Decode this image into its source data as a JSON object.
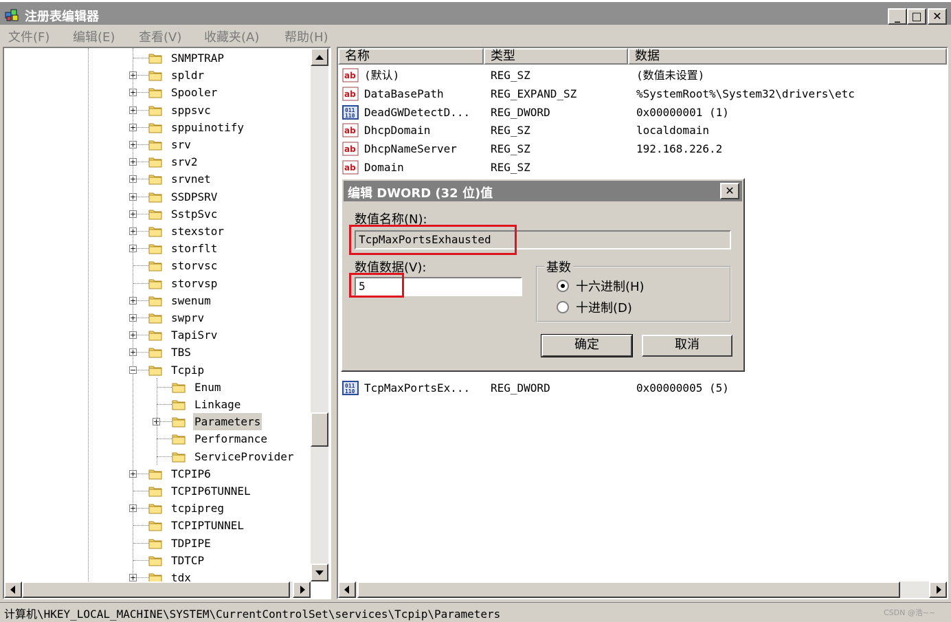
{
  "window": {
    "title": "注册表编辑器",
    "min_glyph": "_",
    "max_glyph": "□",
    "close_glyph": "✕"
  },
  "menu": [
    "文件(F)",
    "编辑(E)",
    "查看(V)",
    "收藏夹(A)",
    "帮助(H)"
  ],
  "tree": {
    "items": [
      {
        "label": "SNMPTRAP",
        "level": 0,
        "expander": ""
      },
      {
        "label": "spldr",
        "level": 0,
        "expander": "+"
      },
      {
        "label": "Spooler",
        "level": 0,
        "expander": "+"
      },
      {
        "label": "sppsvc",
        "level": 0,
        "expander": "+"
      },
      {
        "label": "sppuinotify",
        "level": 0,
        "expander": "+"
      },
      {
        "label": "srv",
        "level": 0,
        "expander": "+"
      },
      {
        "label": "srv2",
        "level": 0,
        "expander": "+"
      },
      {
        "label": "srvnet",
        "level": 0,
        "expander": "+"
      },
      {
        "label": "SSDPSRV",
        "level": 0,
        "expander": "+"
      },
      {
        "label": "SstpSvc",
        "level": 0,
        "expander": "+"
      },
      {
        "label": "stexstor",
        "level": 0,
        "expander": "+"
      },
      {
        "label": "storflt",
        "level": 0,
        "expander": "+"
      },
      {
        "label": "storvsc",
        "level": 0,
        "expander": ""
      },
      {
        "label": "storvsp",
        "level": 0,
        "expander": ""
      },
      {
        "label": "swenum",
        "level": 0,
        "expander": "+"
      },
      {
        "label": "swprv",
        "level": 0,
        "expander": "+"
      },
      {
        "label": "TapiSrv",
        "level": 0,
        "expander": "+"
      },
      {
        "label": "TBS",
        "level": 0,
        "expander": "+"
      },
      {
        "label": "Tcpip",
        "level": 0,
        "expander": "−"
      },
      {
        "label": "Enum",
        "level": 1,
        "expander": ""
      },
      {
        "label": "Linkage",
        "level": 1,
        "expander": ""
      },
      {
        "label": "Parameters",
        "level": 1,
        "expander": "+",
        "selected": true
      },
      {
        "label": "Performance",
        "level": 1,
        "expander": ""
      },
      {
        "label": "ServiceProvider",
        "level": 1,
        "expander": ""
      },
      {
        "label": "TCPIP6",
        "level": 0,
        "expander": "+"
      },
      {
        "label": "TCPIP6TUNNEL",
        "level": 0,
        "expander": ""
      },
      {
        "label": "tcpipreg",
        "level": 0,
        "expander": "+"
      },
      {
        "label": "TCPIPTUNNEL",
        "level": 0,
        "expander": ""
      },
      {
        "label": "TDPIPE",
        "level": 0,
        "expander": ""
      },
      {
        "label": "TDTCP",
        "level": 0,
        "expander": ""
      },
      {
        "label": "tdx",
        "level": 0,
        "expander": "+"
      }
    ]
  },
  "list": {
    "headers": [
      "名称",
      "类型",
      "数据"
    ],
    "rows": [
      {
        "icon": "string-value-icon",
        "name": "(默认)",
        "type": "REG_SZ",
        "data": "(数值未设置)"
      },
      {
        "icon": "string-value-icon",
        "name": "DataBasePath",
        "type": "REG_EXPAND_SZ",
        "data": "%SystemRoot%\\System32\\drivers\\etc"
      },
      {
        "icon": "binary-value-icon",
        "name": "DeadGWDetectD...",
        "type": "REG_DWORD",
        "data": "0x00000001 (1)"
      },
      {
        "icon": "string-value-icon",
        "name": "DhcpDomain",
        "type": "REG_SZ",
        "data": "localdomain"
      },
      {
        "icon": "string-value-icon",
        "name": "DhcpNameServer",
        "type": "REG_SZ",
        "data": "192.168.226.2"
      },
      {
        "icon": "string-value-icon",
        "name": "Domain",
        "type": "REG_SZ",
        "data": ""
      }
    ],
    "bottom_row": {
      "icon": "binary-value-icon",
      "name": "TcpMaxPortsEx...",
      "type": "REG_DWORD",
      "data": "0x00000005 (5)"
    }
  },
  "dialog": {
    "title": "编辑 DWORD (32 位)值",
    "close_glyph": "✕",
    "name_label": "数值名称(N):",
    "name_value": "TcpMaxPortsExhausted",
    "data_label": "数值数据(V):",
    "data_value": "5",
    "base_label": "基数",
    "radio_hex": "十六进制(H)",
    "radio_dec": "十进制(D)",
    "ok_label": "确定",
    "cancel_label": "取消",
    "highlight_color": "#e0141e"
  },
  "status": {
    "path": "计算机\\HKEY_LOCAL_MACHINE\\SYSTEM\\CurrentControlSet\\services\\Tcpip\\Parameters",
    "watermark": "CSDN @浩~~"
  }
}
